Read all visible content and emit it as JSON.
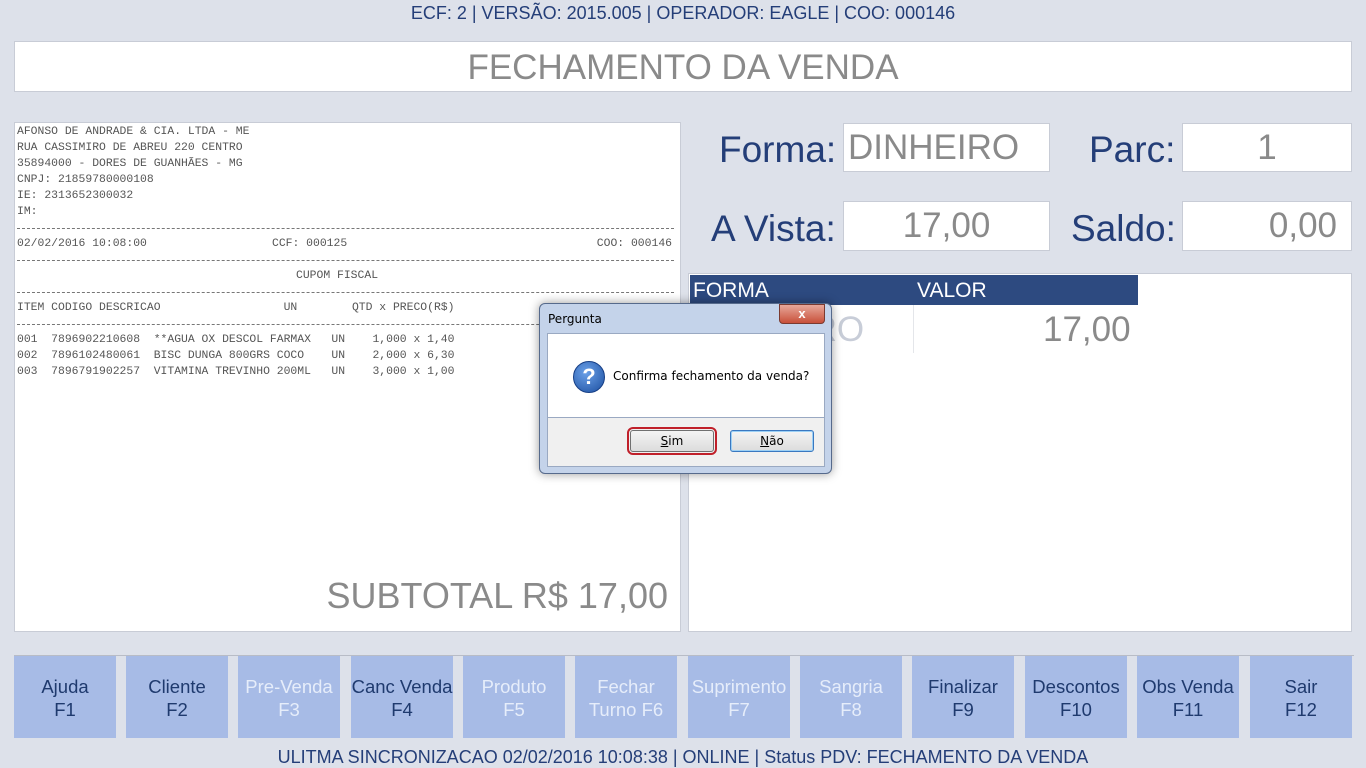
{
  "header": {
    "status": "ECF: 2 | VERSÃO: 2015.005 | OPERADOR: EAGLE | COO: 000146",
    "title": "FECHAMENTO DA VENDA"
  },
  "receipt": {
    "company": "AFONSO DE ANDRADE & CIA. LTDA - ME",
    "address": "RUA CASSIMIRO DE ABREU 220 CENTRO",
    "city": "35894000 - DORES DE GUANHÃES - MG",
    "cnpj": "CNPJ: 21859780000108",
    "ie": "IE: 2313652300032",
    "im": "IM:",
    "datetime": "02/02/2016 10:08:00",
    "ccf": "CCF: 000125",
    "coo": "COO: 000146",
    "cupom": "CUPOM FISCAL",
    "columns": "ITEM CODIGO DESCRICAO                  UN        QTD x PRECO(R$)",
    "items": [
      "001  7896902210608  **AGUA OX DESCOL FARMAX   UN    1,000 x 1,40",
      "002  7896102480061  BISC DUNGA 800GRS COCO    UN    2,000 x 6,30",
      "003  7896791902257  VITAMINA TREVINHO 200ML   UN    3,000 x 1,00"
    ],
    "subtotal": "SUBTOTAL R$ 17,00"
  },
  "payment": {
    "forma_label": "Forma:",
    "forma_value": "DINHEIRO",
    "parc_label": "Parc:",
    "parc_value": "1",
    "avista_label": "A Vista:",
    "avista_value": "17,00",
    "saldo_label": "Saldo:",
    "saldo_value": "0,00",
    "table": {
      "headers": [
        "FORMA",
        "VALOR"
      ],
      "rows": [
        {
          "forma": "DINHEIRO",
          "valor": "17,00"
        }
      ]
    }
  },
  "fkeys": [
    {
      "label": "Ajuda",
      "key": "F1",
      "enabled": true
    },
    {
      "label": "Cliente",
      "key": "F2",
      "enabled": true
    },
    {
      "label": "Pre-Venda",
      "key": "F3",
      "enabled": false
    },
    {
      "label": "Canc Venda",
      "key": "F4",
      "enabled": true
    },
    {
      "label": "Produto",
      "key": "F5",
      "enabled": false
    },
    {
      "label": "Fechar",
      "key": "Turno F6",
      "enabled": false
    },
    {
      "label": "Suprimento",
      "key": "F7",
      "enabled": false
    },
    {
      "label": "Sangria",
      "key": "F8",
      "enabled": false
    },
    {
      "label": "Finalizar",
      "key": "F9",
      "enabled": true
    },
    {
      "label": "Descontos",
      "key": "F10",
      "enabled": true
    },
    {
      "label": "Obs Venda",
      "key": "F11",
      "enabled": true
    },
    {
      "label": "Sair",
      "key": "F12",
      "enabled": true
    }
  ],
  "status_bar": "ULITMA SINCRONIZACAO 02/02/2016 10:08:38 | ONLINE | Status PDV: FECHAMENTO DA VENDA",
  "dialog": {
    "title": "Pergunta",
    "close": "x",
    "icon": "question-icon",
    "message": "Confirma fechamento da venda?",
    "yes": {
      "first": "S",
      "rest": "im"
    },
    "no": {
      "first": "N",
      "rest": "ão"
    }
  }
}
